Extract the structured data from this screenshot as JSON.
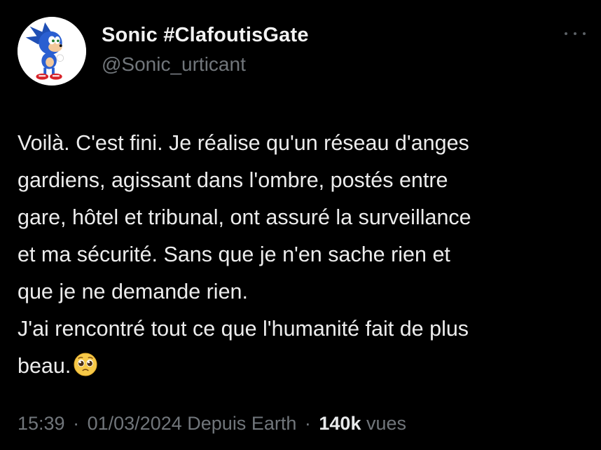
{
  "author": {
    "display_name": "Sonic #ClafoutisGate",
    "handle": "@Sonic_urticant",
    "avatar_icon": "sonic-avatar-icon"
  },
  "more_icon": "more-options-icon",
  "tweet": {
    "lines": [
      "Voilà. C'est fini. Je réalise qu'un réseau d'anges",
      "gardiens, agissant dans l'ombre, postés entre",
      "gare, hôtel et tribunal, ont assuré la surveillance",
      "et ma sécurité. Sans que je n'en sache rien et",
      "que je ne demande rien.",
      "J'ai rencontré tout ce que l'humanité fait de plus",
      "beau."
    ],
    "emoji_icon": "pleading-face-emoji-icon"
  },
  "meta": {
    "time": "15:39",
    "date": "01/03/2024",
    "source": "Depuis Earth",
    "separator": "·",
    "views_count": "140k",
    "views_label": "vues"
  },
  "colors": {
    "background": "#000000",
    "primary_text": "#e7e9ea",
    "secondary_text": "#71767b"
  }
}
